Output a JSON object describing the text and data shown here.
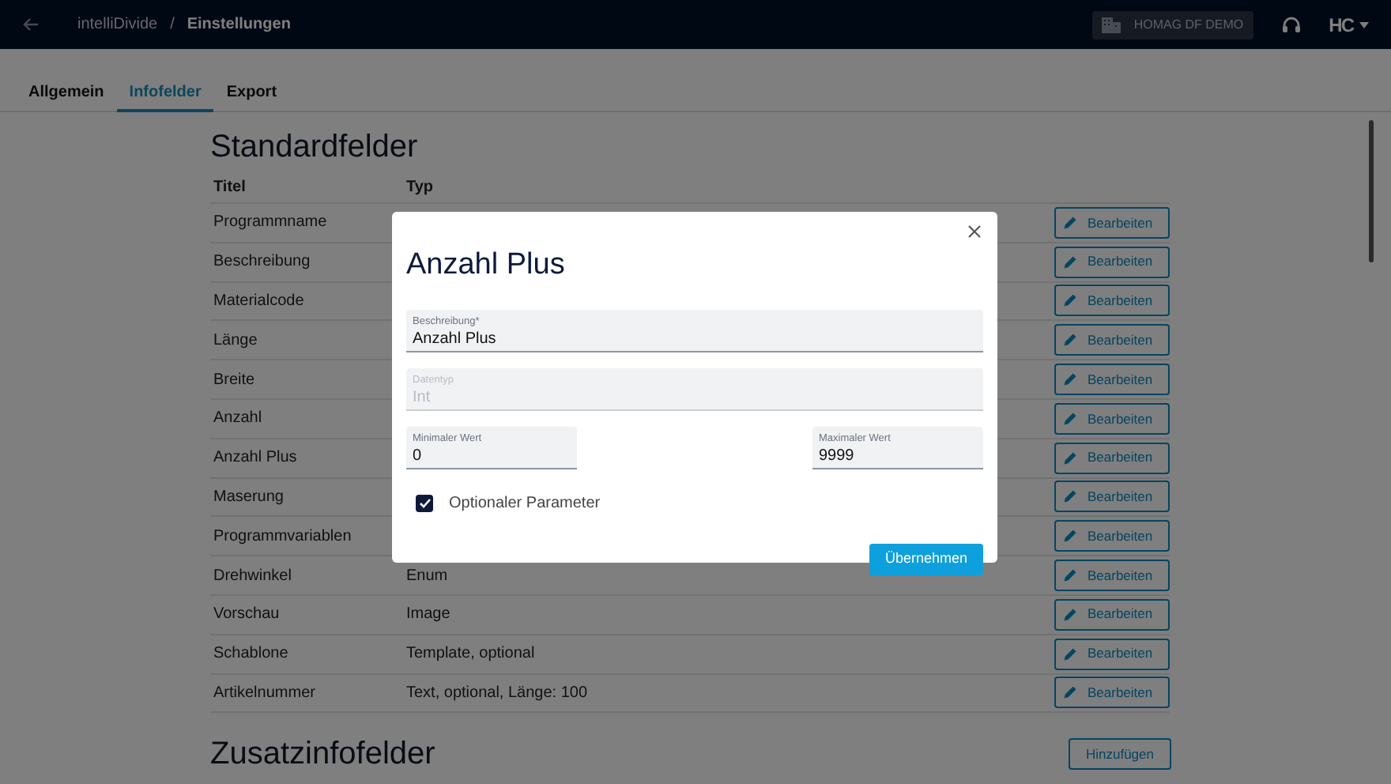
{
  "navbar": {
    "app_name": "intelliDivide",
    "separator": "/",
    "page_title": "Einstellungen",
    "tenant": "HOMAG DF DEMO",
    "logo": "HC"
  },
  "tabs": [
    {
      "label": "Allgemein",
      "selected": false
    },
    {
      "label": "Infofelder",
      "selected": true
    },
    {
      "label": "Export",
      "selected": false
    }
  ],
  "standard_section": {
    "heading": "Standardfelder",
    "columns": [
      "Titel",
      "Typ"
    ],
    "rows": [
      {
        "title": "Programmname",
        "type": "",
        "action": "Bearbeiten"
      },
      {
        "title": "Beschreibung",
        "type": "",
        "action": "Bearbeiten"
      },
      {
        "title": "Materialcode",
        "type": "",
        "action": "Bearbeiten"
      },
      {
        "title": "Länge",
        "type": "",
        "action": "Bearbeiten"
      },
      {
        "title": "Breite",
        "type": "",
        "action": "Bearbeiten"
      },
      {
        "title": "Anzahl",
        "type": "",
        "action": "Bearbeiten"
      },
      {
        "title": "Anzahl Plus",
        "type": "",
        "action": "Bearbeiten"
      },
      {
        "title": "Maserung",
        "type": "",
        "action": "Bearbeiten"
      },
      {
        "title": "Programmvariablen",
        "type": "",
        "action": "Bearbeiten"
      },
      {
        "title": "Drehwinkel",
        "type": "Enum",
        "action": "Bearbeiten"
      },
      {
        "title": "Vorschau",
        "type": "Image",
        "action": "Bearbeiten"
      },
      {
        "title": "Schablone",
        "type": "Template, optional",
        "action": "Bearbeiten"
      },
      {
        "title": "Artikelnummer",
        "type": "Text, optional, Länge: 100",
        "action": "Bearbeiten"
      }
    ]
  },
  "extra_section": {
    "heading": "Zusatzinfofelder",
    "add_button": "Hinzufügen"
  },
  "dialog": {
    "title": "Anzahl Plus",
    "fields": [
      {
        "label": "Beschreibung*",
        "value": "Anzahl Plus",
        "disabled": false
      },
      {
        "label": "Datentyp",
        "value": "Int",
        "disabled": true
      }
    ],
    "range_fields": [
      {
        "label": "Minimaler Wert",
        "value": "0",
        "disabled": false
      },
      {
        "label": "Maximaler Wert",
        "value": "9999",
        "disabled": false
      }
    ],
    "checkbox": {
      "label": "Optionaler Parameter",
      "checked": true
    },
    "apply_button": "Übernehmen"
  }
}
